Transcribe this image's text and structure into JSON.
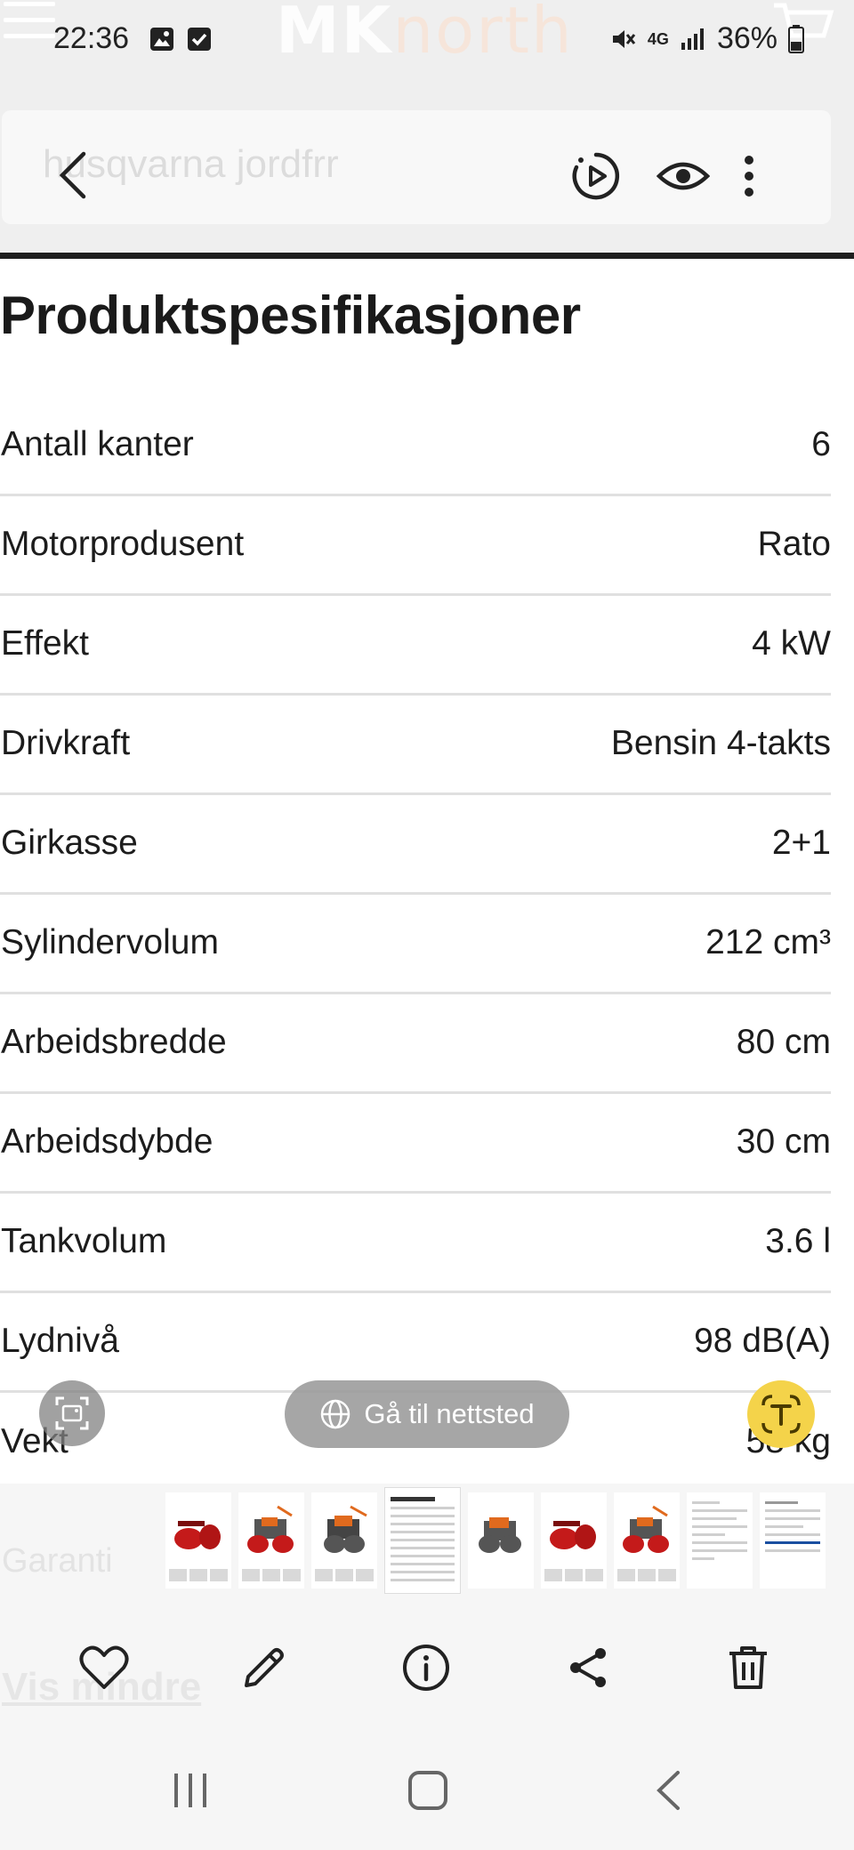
{
  "status_bar": {
    "time": "22:36",
    "network": "4G",
    "battery": "36%"
  },
  "brand": {
    "bold": "MK",
    "light": "north"
  },
  "search": {
    "query": "husqvarna jordfrr"
  },
  "page": {
    "title": "Produktspesifikasjoner"
  },
  "specs": [
    {
      "label": "Antall kanter",
      "value": "6"
    },
    {
      "label": "Motorprodusent",
      "value": "Rato"
    },
    {
      "label": "Effekt",
      "value": "4 kW"
    },
    {
      "label": "Drivkraft",
      "value": "Bensin 4-takts"
    },
    {
      "label": "Girkasse",
      "value": "2+1"
    },
    {
      "label": "Sylindervolum",
      "value": "212 cm³"
    },
    {
      "label": "Arbeidsbredde",
      "value": "80 cm"
    },
    {
      "label": "Arbeidsdybde",
      "value": "30 cm"
    },
    {
      "label": "Tankvolum",
      "value": "3.6 l"
    },
    {
      "label": "Lydnivå",
      "value": "98 dB(A)"
    },
    {
      "label": "Vekt",
      "value": "58 kg"
    }
  ],
  "faded": {
    "garanti": "Garanti",
    "vis_mindre": "Vis mindre"
  },
  "overlay": {
    "goto_site": "Gå til nettsted"
  },
  "colors": {
    "accent_yellow": "#f4d34a",
    "divider": "#e0e0e0",
    "text": "#1c1c1c"
  }
}
